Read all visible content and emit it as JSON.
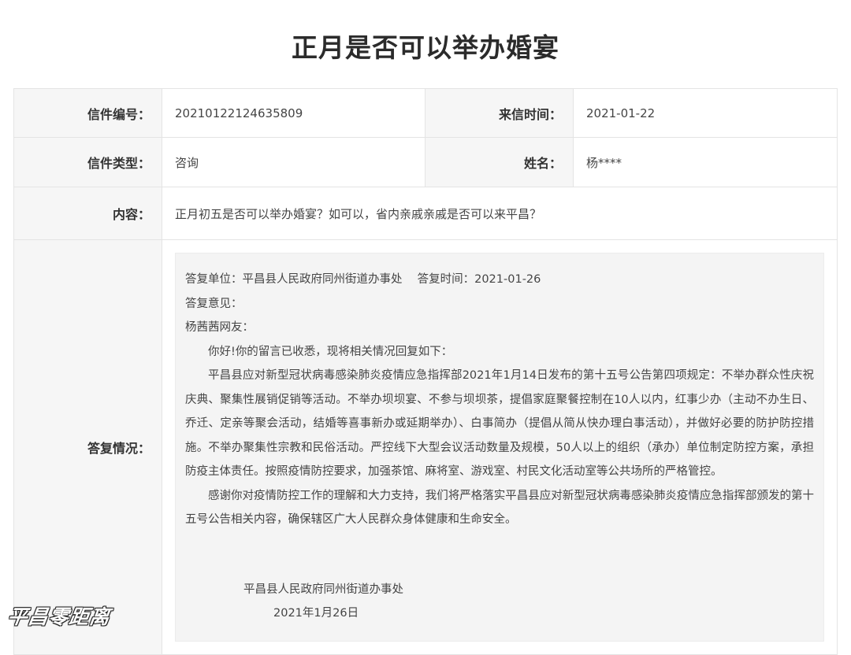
{
  "title": "正月是否可以举办婚宴",
  "letter": {
    "id_label": "信件编号：",
    "id_value": "20210122124635809",
    "date_label": "来信时间：",
    "date_value": "2021-01-22",
    "type_label": "信件类型：",
    "type_value": "咨询",
    "name_label": "姓名：",
    "name_value": "杨****",
    "content_label": "内容：",
    "content_value": "正月初五是否可以举办婚宴？如可以，省内亲戚亲戚是否可以来平昌？"
  },
  "reply": {
    "label": "答复情况：",
    "header": "答复单位：平昌县人民政府同州街道办事处　 答复时间：2021-01-26",
    "opinion_label": "答复意见：",
    "greeting": "杨茜茜网友：",
    "p1": "你好!你的留言已收悉，现将相关情况回复如下：",
    "p2": "平昌县应对新型冠状病毒感染肺炎疫情应急指挥部2021年1月14日发布的第十五号公告第四项规定：不举办群众性庆祝庆典、聚集性展销促销等活动。不举办坝坝宴、不参与坝坝茶，提倡家庭聚餐控制在10人以内，红事少办（主动不办生日、乔迁、定亲等聚会活动，结婚等喜事新办或延期举办）、白事简办（提倡从简从快办理白事活动），并做好必要的防护防控措施。不举办聚集性宗教和民俗活动。严控线下大型会议活动数量及规模，50人以上的组织（承办）单位制定防控方案，承担防疫主体责任。按照疫情防控要求，加强茶馆、麻将室、游戏室、村民文化活动室等公共场所的严格管控。",
    "p3": "感谢你对疫情防控工作的理解和大力支持，我们将严格落实平昌县应对新型冠状病毒感染肺炎疫情应急指挥部颁发的第十五号公告相关内容，确保辖区广大人民群众身体健康和生命安全。",
    "signature_unit": "平昌县人民政府同州街道办事处",
    "signature_date": "2021年1月26日"
  },
  "watermark": "平昌零距离"
}
